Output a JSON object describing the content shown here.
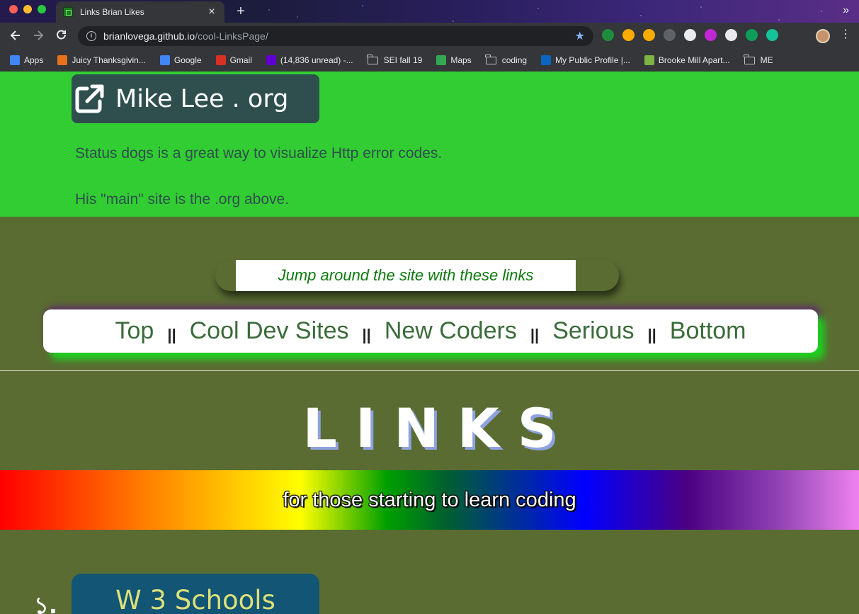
{
  "browser": {
    "tab_title": "Links Brian Likes",
    "tab_close": "×",
    "new_tab": "+",
    "url_host": "brianlovega.github.io",
    "url_path": "/cool-LinksPage/",
    "bookmarks": [
      {
        "label": "Apps",
        "icon": "apps-grid-icon",
        "color": "#4285f4"
      },
      {
        "label": "Juicy Thanksgivin...",
        "icon": "juicy-icon",
        "color": "#e8711c"
      },
      {
        "label": "Google",
        "icon": "google-icon",
        "color": "#4285f4"
      },
      {
        "label": "Gmail",
        "icon": "gmail-icon",
        "color": "#d93025"
      },
      {
        "label": "(14,836 unread) -...",
        "icon": "yahoo-mail-icon",
        "color": "#6001d2"
      },
      {
        "label": "SEI fall 19",
        "icon": "folder-icon"
      },
      {
        "label": "Maps",
        "icon": "maps-icon",
        "color": "#34a853"
      },
      {
        "label": "coding",
        "icon": "folder-icon"
      },
      {
        "label": "My Public Profile |...",
        "icon": "linkedin-icon",
        "color": "#0a66c2"
      },
      {
        "label": "Brooke Mill Apart...",
        "icon": "apartment-icon",
        "color": "#7cb342"
      },
      {
        "label": "ME",
        "icon": "folder-icon"
      }
    ],
    "extensions": [
      "#1e8e3e",
      "#f9ab00",
      "#f9ab00",
      "#5f6368",
      "#e8eaed",
      "#c026d3",
      "#e8eaed",
      "#0f9d58",
      "#15c39a"
    ]
  },
  "page": {
    "featured_link": "Mike Lee . org",
    "description_1": "Status dogs is a great way to visualize Http error codes.",
    "description_2": "His \"main\" site is the .org above.",
    "jump_text": "Jump around the site with these links",
    "nav": [
      "Top",
      "Cool Dev Sites",
      "New Coders",
      "Serious",
      "Bottom"
    ],
    "nav_separator": "||",
    "links_heading": "LINKS",
    "rainbow_subtitle": "for those starting to learn coding",
    "list_number": "১.",
    "first_link": "W 3 Schools"
  }
}
